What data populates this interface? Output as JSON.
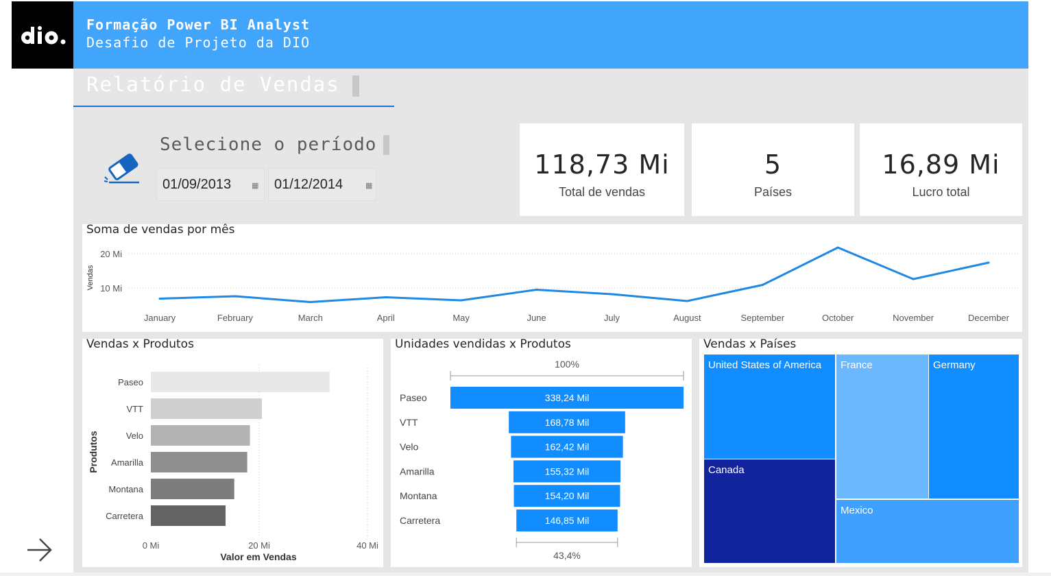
{
  "header": {
    "line1": "Formação Power BI Analyst",
    "line2": "Desafio de Projeto da DIO"
  },
  "logo": {
    "icon": "dio-logo"
  },
  "report": {
    "title": "Relatório de Vendas"
  },
  "filter": {
    "label": "Selecione o período",
    "start_date": "01/09/2013",
    "end_date": "01/12/2014",
    "icon": "eraser-icon"
  },
  "kpis": [
    {
      "value": "118,73 Mi",
      "label": "Total de vendas"
    },
    {
      "value": "5",
      "label": "Países"
    },
    {
      "value": "16,89 Mi",
      "label": "Lucro total"
    }
  ],
  "colors": {
    "header": "#42a5fc",
    "line": "#1e88e5",
    "funnel": "#118dff"
  },
  "chart_data": [
    {
      "type": "line",
      "title": "Soma de vendas por mês",
      "ylabel": "Vendas",
      "yticks": [
        "10 Mi",
        "20 Mi"
      ],
      "ylim": [
        0,
        25
      ],
      "categories": [
        "January",
        "February",
        "March",
        "April",
        "May",
        "June",
        "July",
        "August",
        "September",
        "October",
        "November",
        "December"
      ],
      "values": [
        6.9,
        7.6,
        5.9,
        7.3,
        6.4,
        9.5,
        8.2,
        6.2,
        10.9,
        21.8,
        12.6,
        17.4
      ]
    },
    {
      "type": "bar",
      "orientation": "horizontal",
      "title": "Vendas x Produtos",
      "xlabel": "Valor em Vendas",
      "ylabel": "Produtos",
      "xticks": [
        "0 Mi",
        "20 Mi",
        "40 Mi"
      ],
      "xlim": [
        0,
        40
      ],
      "categories": [
        "Paseo",
        "VTT",
        "Velo",
        "Amarilla",
        "Montana",
        "Carretera"
      ],
      "values": [
        33.0,
        20.5,
        18.3,
        17.8,
        15.4,
        13.8
      ],
      "colors": [
        "#e8e8e8",
        "#cfcfcf",
        "#b3b3b3",
        "#8f8f8f",
        "#7d7d7d",
        "#646464"
      ]
    },
    {
      "type": "funnel",
      "title": "Unidades vendidas x Produtos",
      "top_percent": "100%",
      "bottom_percent": "43,4%",
      "categories": [
        "Paseo",
        "VTT",
        "Velo",
        "Amarilla",
        "Montana",
        "Carretera"
      ],
      "values": [
        338.24,
        168.78,
        162.42,
        155.32,
        154.2,
        146.85
      ],
      "labels": [
        "338,24 Mil",
        "168,78 Mil",
        "162,42 Mil",
        "155,32 Mil",
        "154,20 Mil",
        "146,85 Mil"
      ]
    },
    {
      "type": "treemap",
      "title": "Vendas x Países",
      "categories": [
        "United States of America",
        "Canada",
        "France",
        "Germany",
        "Mexico"
      ],
      "colors": [
        "#118dff",
        "#12239e",
        "#6bb8ff",
        "#118dff",
        "#3fa0ff"
      ]
    }
  ]
}
